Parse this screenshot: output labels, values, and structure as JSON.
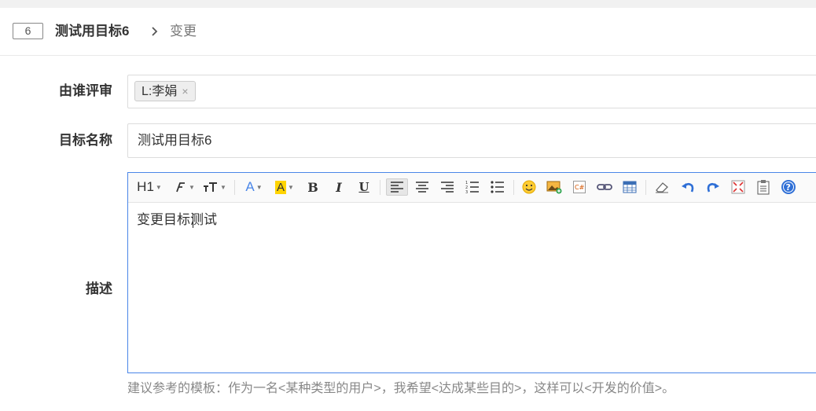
{
  "header": {
    "id": "6",
    "title": "测试用目标6",
    "breadcrumb": "变更"
  },
  "form": {
    "reviewer": {
      "label": "由谁评审",
      "tag": "L:李娟",
      "remove": "×"
    },
    "name": {
      "label": "目标名称",
      "value": "测试用目标6"
    },
    "description": {
      "label": "描述",
      "content": "变更目标测试",
      "hint": "建议参考的模板：作为一名<某种类型的用户>，我希望<达成某些目的>，这样可以<开发的价值>。"
    }
  },
  "toolbar": {
    "heading": "H1",
    "font_family_icon": "font-family-icon",
    "font_size_icon": "font-size-icon",
    "font_color_letter": "A",
    "highlight_letter": "A",
    "bold": "B",
    "italic": "I",
    "underline": "U",
    "icons": [
      "align-left-icon",
      "align-center-icon",
      "align-right-icon",
      "ordered-list-icon",
      "unordered-list-icon",
      "emoticon-icon",
      "image-icon",
      "code-icon",
      "link-icon",
      "table-icon",
      "eraser-icon",
      "undo-icon",
      "redo-icon",
      "fullscreen-icon",
      "paste-icon",
      "help-icon"
    ]
  },
  "colors": {
    "accent": "#4a86e8",
    "highlight": "#ffd400"
  }
}
